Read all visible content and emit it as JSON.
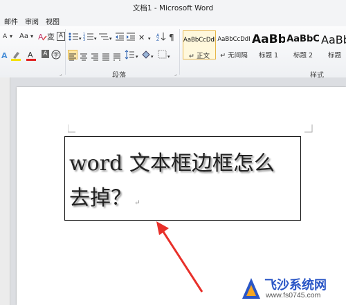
{
  "window": {
    "title": "文档1 - Microsoft Word"
  },
  "menu": {
    "items": [
      "邮件",
      "审阅",
      "视图"
    ]
  },
  "ribbon": {
    "paragraph_group_label": "段落",
    "styles_group_label": "样式",
    "font_buttons": [
      "A",
      "A",
      "Aa",
      "A",
      "A"
    ],
    "styles": [
      {
        "sample": "AaBbCcDdI",
        "name": "↵ 正文",
        "selected": true
      },
      {
        "sample": "AaBbCcDdI",
        "name": "↵ 无间隔",
        "selected": false
      },
      {
        "sample": "AaBb",
        "name": "标题 1",
        "selected": false
      },
      {
        "sample": "AaBbC",
        "name": "标题 2",
        "selected": false
      },
      {
        "sample": "AaBb",
        "name": "标题",
        "selected": false
      }
    ]
  },
  "document": {
    "textbox_text": "word 文本框边框怎么去掉？",
    "paragraph_mark": "↵"
  },
  "watermark": {
    "name": "飞沙系统网",
    "url": "www.fs0745.com"
  },
  "colors": {
    "arrow": "#e8302a",
    "watermark_blue": "#2a56c6",
    "selected_style_border": "#e7b64a"
  }
}
